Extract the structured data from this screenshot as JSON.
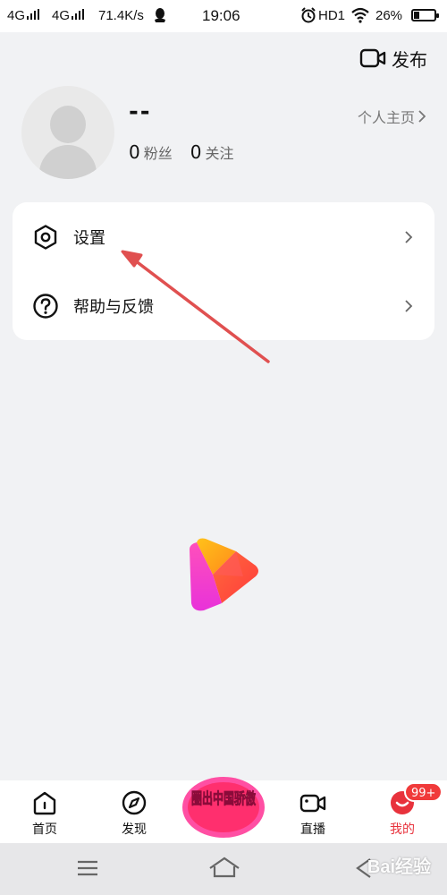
{
  "status_bar": {
    "net1": "4G",
    "net2": "4G",
    "speed": "71.4K/s",
    "time": "19:06",
    "hd": "HD1",
    "battery": "26%",
    "battery_level": 0.26
  },
  "header": {
    "publish_label": "发布"
  },
  "profile": {
    "username": "--",
    "profile_link": "个人主页",
    "fans_count": "0",
    "fans_label": "粉丝",
    "following_count": "0",
    "following_label": "关注"
  },
  "menu": {
    "settings_label": "设置",
    "help_label": "帮助与反馈"
  },
  "bottom_nav": {
    "home": "首页",
    "discover": "发现",
    "promo": "圈出中国骄傲",
    "live": "直播",
    "me": "我的",
    "badge": "99+"
  },
  "watermark": "Bai经验",
  "colors": {
    "accent": "#e8323c",
    "annotation": "#e05050",
    "background": "#f1f2f4"
  }
}
